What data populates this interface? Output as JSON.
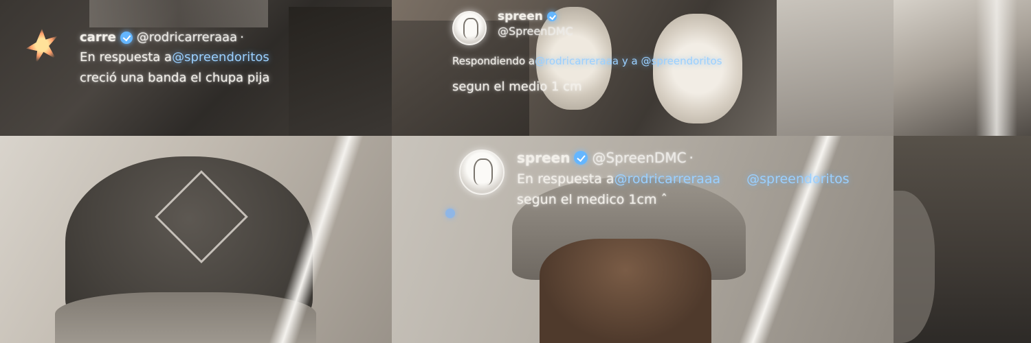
{
  "tweets": [
    {
      "name": "carre",
      "handle": "@rodricarreraaa",
      "separator": "·",
      "reply_prefix": "En respuesta a ",
      "mention": "@spreendoritos",
      "text": "creció una banda el chupa pija"
    },
    {
      "name": "spreen",
      "handle": "@SpreenDMC",
      "reply_prefix": "Respondiendo a ",
      "mention_1": "@rodricarreraaa",
      "mention_joiner": " y a ",
      "mention_2": "@spreendoritos",
      "text": "segun el medio 1 cm"
    },
    {
      "name": "spreen",
      "handle": "@SpreenDMC",
      "separator": "·",
      "reply_prefix": "En respuesta a ",
      "mention_1": "@rodricarreraaa",
      "mention_2": "@spreendoritos",
      "text": "segun el medico 1cm ˆ"
    }
  ],
  "colors": {
    "mention": "#9bd0ff",
    "verified_badge": "#64b6ff",
    "text": "#f2efe9"
  },
  "icons": [
    "verified-badge-icon",
    "spiky-logo-avatar",
    "profile-avatar"
  ]
}
